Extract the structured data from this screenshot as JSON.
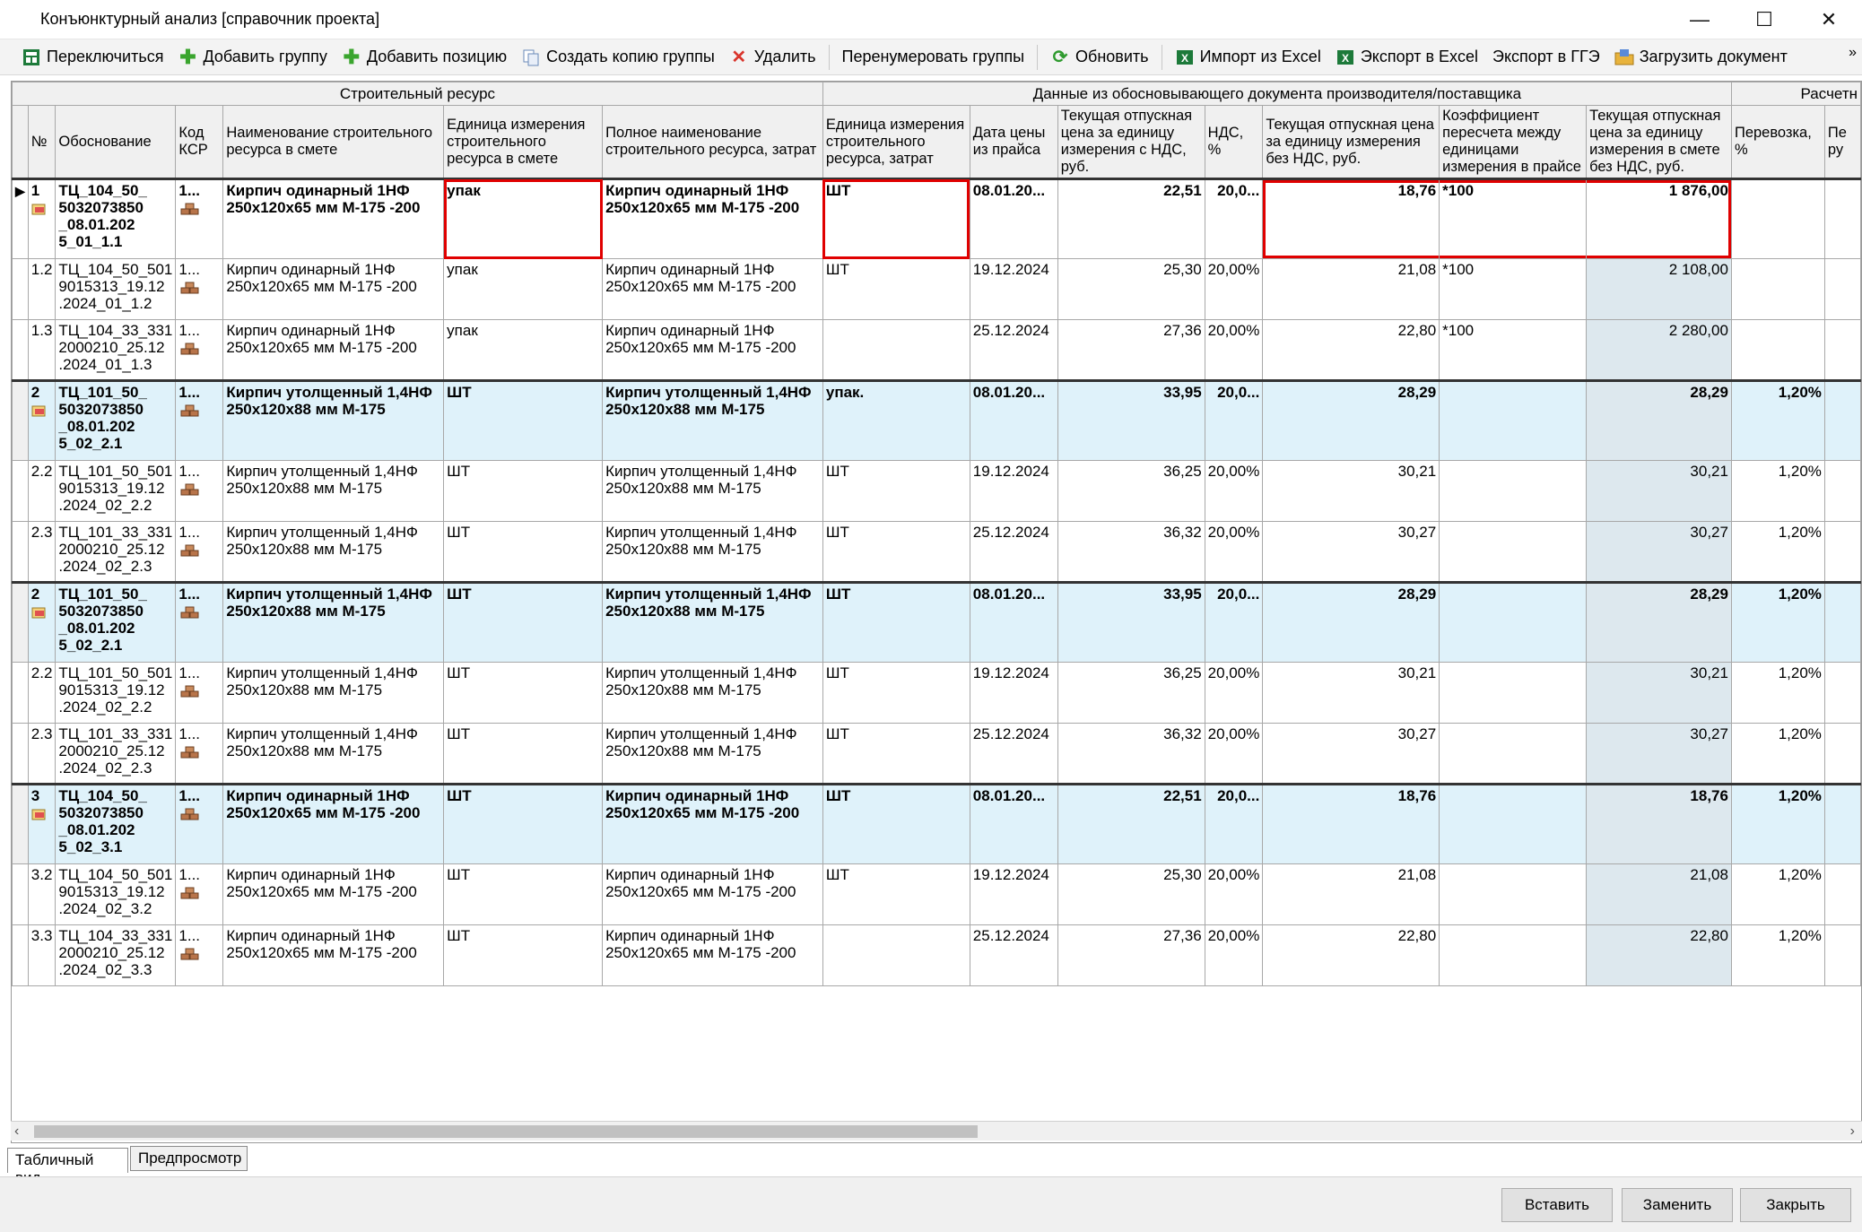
{
  "window": {
    "title": "Конъюнктурный анализ [справочник проекта]",
    "minimize_glyph": "—",
    "maximize_glyph": "☐",
    "close_glyph": "✕"
  },
  "toolbar": {
    "switch": "Переключиться",
    "add_group": "Добавить группу",
    "add_position": "Добавить позицию",
    "copy_group": "Создать копию группы",
    "delete": "Удалить",
    "renumber": "Перенумеровать группы",
    "refresh": "Обновить",
    "import_excel": "Импорт из Excel",
    "export_excel": "Экспорт в Excel",
    "export_gge": "Экспорт в ГГЭ",
    "load_document": "Загрузить документ",
    "more": "»"
  },
  "table": {
    "bands": {
      "resource": "Строительный ресурс",
      "manufacturer": "Данные из обосновывающего документа производителя/поставщика",
      "calc": "Расчетн"
    },
    "columns": {
      "num": "№",
      "basis": "Обоснование",
      "ksr": "Код КСР",
      "name": "Наименование строительного ресурса в смете",
      "unit": "Единица измерения строительного ресурса в смете",
      "full_name": "Полное наименование строительного ресурса, затрат",
      "unit2": "Единица измерения строительного ресурса, затрат",
      "date": "Дата цены из прайса",
      "price_vat": "Текущая отпускная цена за единицу измерения с НДС, руб.",
      "vat": "НДС, %",
      "price_novat": "Текущая отпускная цена за единицу измерения без НДС, руб.",
      "coef": "Коэффициент пересчета между единицами измерения в прайсе",
      "price_smeta": "Текущая отпускная цена за единицу измерения в смете без НДС, руб.",
      "transport": "Перевозка, %",
      "last": "Пе ру"
    },
    "rows": [
      {
        "type": "grp",
        "num": "1",
        "basis": "ТЦ_104_50_ 5032073850 _08.01.202 5_01_1.1",
        "ksr": "1...",
        "name": "Кирпич одинарный 1НФ 250x120x65 мм М-175 -200",
        "unit": "упак",
        "full_name": "Кирпич одинарный 1НФ 250x120x65 мм М-175 -200",
        "unit2": "ШТ",
        "date": "08.01.20...",
        "price_vat": "22,51",
        "vat": "20,0...",
        "price_novat": "18,76",
        "coef": "*100",
        "price_smeta": "1 876,00",
        "transport": "",
        "last": ""
      },
      {
        "type": "item",
        "num": "1.2",
        "basis": "ТЦ_104_50_501 9015313_19.12 .2024_01_1.2",
        "ksr": "1...",
        "name": "Кирпич одинарный 1НФ 250x120x65 мм М-175 -200",
        "unit": "упак",
        "full_name": "Кирпич одинарный 1НФ 250x120x65 мм М-175 -200",
        "unit2": "ШТ",
        "date": "19.12.2024",
        "price_vat": "25,30",
        "vat": "20,00%",
        "price_novat": "21,08",
        "coef": "*100",
        "price_smeta": "2 108,00",
        "transport": "",
        "last": ""
      },
      {
        "type": "item",
        "num": "1.3",
        "basis": "ТЦ_104_33_331 2000210_25.12 .2024_01_1.3",
        "ksr": "1...",
        "name": "Кирпич одинарный 1НФ 250x120x65 мм М-175 -200",
        "unit": "упак",
        "full_name": "Кирпич одинарный 1НФ 250x120x65 мм М-175 -200",
        "unit2": "",
        "date": "25.12.2024",
        "price_vat": "27,36",
        "vat": "20,00%",
        "price_novat": "22,80",
        "coef": "*100",
        "price_smeta": "2 280,00",
        "transport": "",
        "last": ""
      },
      {
        "type": "grp",
        "num": "2",
        "basis": "ТЦ_101_50_ 5032073850 _08.01.202 5_02_2.1",
        "ksr": "1...",
        "name": "Кирпич утолщенный 1,4НФ 250x120x88 мм М-175",
        "unit": "ШТ",
        "full_name": "Кирпич утолщенный 1,4НФ 250x120x88 мм М-175",
        "unit2": "упак.",
        "date": "08.01.20...",
        "price_vat": "33,95",
        "vat": "20,0...",
        "price_novat": "28,29",
        "coef": "",
        "price_smeta": "28,29",
        "transport": "1,20%",
        "last": ""
      },
      {
        "type": "item",
        "num": "2.2",
        "basis": "ТЦ_101_50_501 9015313_19.12 .2024_02_2.2",
        "ksr": "1...",
        "name": "Кирпич утолщенный 1,4НФ 250x120x88 мм М-175",
        "unit": "ШТ",
        "full_name": "Кирпич утолщенный 1,4НФ 250x120x88 мм М-175",
        "unit2": "ШТ",
        "date": "19.12.2024",
        "price_vat": "36,25",
        "vat": "20,00%",
        "price_novat": "30,21",
        "coef": "",
        "price_smeta": "30,21",
        "transport": "1,20%",
        "last": ""
      },
      {
        "type": "item",
        "num": "2.3",
        "basis": "ТЦ_101_33_331 2000210_25.12 .2024_02_2.3",
        "ksr": "1...",
        "name": "Кирпич утолщенный 1,4НФ 250x120x88 мм М-175",
        "unit": "ШТ",
        "full_name": "Кирпич утолщенный 1,4НФ 250x120x88 мм М-175",
        "unit2": "ШТ",
        "date": "25.12.2024",
        "price_vat": "36,32",
        "vat": "20,00%",
        "price_novat": "30,27",
        "coef": "",
        "price_smeta": "30,27",
        "transport": "1,20%",
        "last": ""
      },
      {
        "type": "grp",
        "num": "2",
        "basis": "ТЦ_101_50_ 5032073850 _08.01.202 5_02_2.1",
        "ksr": "1...",
        "name": "Кирпич утолщенный 1,4НФ 250x120x88 мм М-175",
        "unit": "ШТ",
        "full_name": "Кирпич утолщенный 1,4НФ 250x120x88 мм М-175",
        "unit2": "ШТ",
        "date": "08.01.20...",
        "price_vat": "33,95",
        "vat": "20,0...",
        "price_novat": "28,29",
        "coef": "",
        "price_smeta": "28,29",
        "transport": "1,20%",
        "last": ""
      },
      {
        "type": "item",
        "num": "2.2",
        "basis": "ТЦ_101_50_501 9015313_19.12 .2024_02_2.2",
        "ksr": "1...",
        "name": "Кирпич утолщенный 1,4НФ 250x120x88 мм М-175",
        "unit": "ШТ",
        "full_name": "Кирпич утолщенный 1,4НФ 250x120x88 мм М-175",
        "unit2": "ШТ",
        "date": "19.12.2024",
        "price_vat": "36,25",
        "vat": "20,00%",
        "price_novat": "30,21",
        "coef": "",
        "price_smeta": "30,21",
        "transport": "1,20%",
        "last": ""
      },
      {
        "type": "item",
        "num": "2.3",
        "basis": "ТЦ_101_33_331 2000210_25.12 .2024_02_2.3",
        "ksr": "1...",
        "name": "Кирпич утолщенный 1,4НФ 250x120x88 мм М-175",
        "unit": "ШТ",
        "full_name": "Кирпич утолщенный 1,4НФ 250x120x88 мм М-175",
        "unit2": "ШТ",
        "date": "25.12.2024",
        "price_vat": "36,32",
        "vat": "20,00%",
        "price_novat": "30,27",
        "coef": "",
        "price_smeta": "30,27",
        "transport": "1,20%",
        "last": ""
      },
      {
        "type": "grp",
        "num": "3",
        "basis": "ТЦ_104_50_ 5032073850 _08.01.202 5_02_3.1",
        "ksr": "1...",
        "name": "Кирпич одинарный 1НФ 250x120x65 мм М-175 -200",
        "unit": "ШТ",
        "full_name": "Кирпич одинарный 1НФ 250x120x65 мм М-175 -200",
        "unit2": "ШТ",
        "date": "08.01.20...",
        "price_vat": "22,51",
        "vat": "20,0...",
        "price_novat": "18,76",
        "coef": "",
        "price_smeta": "18,76",
        "transport": "1,20%",
        "last": ""
      },
      {
        "type": "item",
        "num": "3.2",
        "basis": "ТЦ_104_50_501 9015313_19.12 .2024_02_3.2",
        "ksr": "1...",
        "name": "Кирпич одинарный 1НФ 250x120x65 мм М-175 -200",
        "unit": "ШТ",
        "full_name": "Кирпич одинарный 1НФ 250x120x65 мм М-175 -200",
        "unit2": "ШТ",
        "date": "19.12.2024",
        "price_vat": "25,30",
        "vat": "20,00%",
        "price_novat": "21,08",
        "coef": "",
        "price_smeta": "21,08",
        "transport": "1,20%",
        "last": ""
      },
      {
        "type": "item",
        "num": "3.3",
        "basis": "ТЦ_104_33_331 2000210_25.12 .2024_02_3.3",
        "ksr": "1...",
        "name": "Кирпич одинарный 1НФ 250x120x65 мм М-175 -200",
        "unit": "ШТ",
        "full_name": "Кирпич одинарный 1НФ 250x120x65 мм М-175 -200",
        "unit2": "",
        "date": "25.12.2024",
        "price_vat": "27,36",
        "vat": "20,00%",
        "price_novat": "22,80",
        "coef": "",
        "price_smeta": "22,80",
        "transport": "1,20%",
        "last": ""
      }
    ]
  },
  "tabs": {
    "table_view": "Табличный вид",
    "preview": "Предпросмотр"
  },
  "footer": {
    "insert": "Вставить",
    "replace": "Заменить",
    "close": "Закрыть"
  },
  "colors": {
    "group_row_bg": "#dff2fa",
    "highlight_border": "#e00000",
    "excel_green": "#1d7a3a",
    "add_green": "#3aa52e",
    "delete_red": "#d9342b"
  }
}
